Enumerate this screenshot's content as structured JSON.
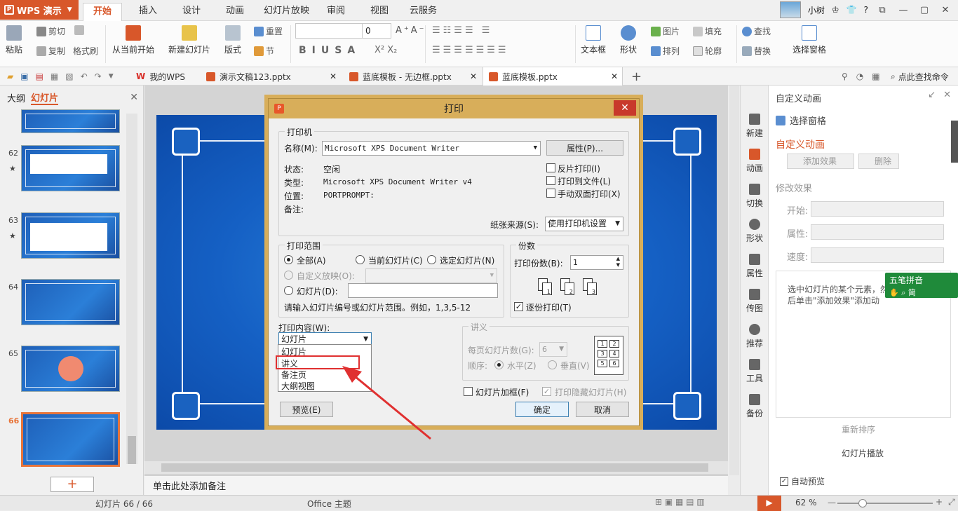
{
  "app": {
    "name": "WPS 演示"
  },
  "menu_tabs": [
    "开始",
    "插入",
    "设计",
    "动画",
    "幻灯片放映",
    "审阅",
    "视图",
    "云服务"
  ],
  "user": {
    "name": "小树"
  },
  "ribbon": {
    "paste": "粘贴",
    "cut": "剪切",
    "copy": "复制",
    "format_painter": "格式刷",
    "from_current": "从当前开始",
    "new_slide": "新建幻灯片",
    "layout": "版式",
    "reset": "重置",
    "section": "节",
    "font_size": "0",
    "textbox": "文本框",
    "shape": "形状",
    "picture": "图片",
    "fill": "填充",
    "arrange": "排列",
    "outline": "轮廓",
    "find": "查找",
    "replace": "替换",
    "select_pane": "选择窗格"
  },
  "doc_tabs": {
    "mywps": "我的WPS",
    "tab1": "演示文稿123.pptx",
    "tab2": "蓝底模板 - 无边框.pptx",
    "tab3": "蓝底模板.pptx",
    "search": "点此查找命令"
  },
  "left_panel": {
    "outline": "大纲",
    "slides": "幻灯片",
    "slide_numbers": [
      "62",
      "63",
      "64",
      "65",
      "66"
    ]
  },
  "notes": "单击此处添加备注",
  "right_strip": [
    "新建",
    "动画",
    "切换",
    "形状",
    "属性",
    "传图",
    "推荐",
    "工具",
    "备份"
  ],
  "anim_panel": {
    "header": "自定义动画",
    "select_pane": "选择窗格",
    "title": "自定义动画",
    "add_effect": "添加效果",
    "delete": "删除",
    "modify": "修改效果",
    "start": "开始:",
    "property": "属性:",
    "speed": "速度:",
    "hint": "选中幻灯片的某个元素，然后单击\"添加效果\"添加动画。",
    "reorder": "重新排序",
    "play": "幻灯片播放",
    "auto_preview": "自动预览"
  },
  "ime": {
    "name": "五笔拼音",
    "mode": "简"
  },
  "statusbar": {
    "slide_info": "幻灯片 66 / 66",
    "theme": "Office 主题",
    "zoom": "62 %"
  },
  "dialog": {
    "title": "打印",
    "printer_group": "打印机",
    "name_label": "名称(M):",
    "printer_name": "Microsoft XPS Document Writer",
    "properties_btn": "属性(P)...",
    "status_label": "状态:",
    "status_value": "空闲",
    "type_label": "类型:",
    "type_value": "Microsoft XPS Document Writer v4",
    "location_label": "位置:",
    "location_value": "PORTPROMPT:",
    "comment_label": "备注:",
    "reverse_print": "反片打印(I)",
    "print_to_file": "打印到文件(L)",
    "manual_duplex": "手动双面打印(X)",
    "paper_source_label": "纸张来源(S):",
    "paper_source_value": "使用打印机设置",
    "range_group": "打印范围",
    "all": "全部(A)",
    "current_slide": "当前幻灯片(C)",
    "selected_slides": "选定幻灯片(N)",
    "custom_show": "自定义放映(O):",
    "slides": "幻灯片(D):",
    "range_hint": "请输入幻灯片编号或幻灯片范围。例如，1,3,5-12",
    "copies_group": "份数",
    "copies_label": "打印份数(B):",
    "copies_value": "1",
    "collate": "逐份打印(T)",
    "content_label": "打印内容(W):",
    "content_value": "幻灯片",
    "content_options": [
      "幻灯片",
      "讲义",
      "备注页",
      "大纲视图"
    ],
    "handout_group": "讲义",
    "per_page_label": "每页幻灯片数(G):",
    "per_page_value": "6",
    "order_label": "顺序:",
    "horizontal": "水平(Z)",
    "vertical": "垂直(V)",
    "frame_slides": "幻灯片加框(F)",
    "print_hidden": "打印隐藏幻灯片(H)",
    "preview_btn": "预览(E)",
    "ok_btn": "确定",
    "cancel_btn": "取消"
  },
  "colors": {
    "accent": "#d8572a",
    "slide_blue": "#1560c4",
    "dialog_frame": "#d8ae5a",
    "close_red": "#c8392b",
    "highlight_red": "#e03030"
  }
}
